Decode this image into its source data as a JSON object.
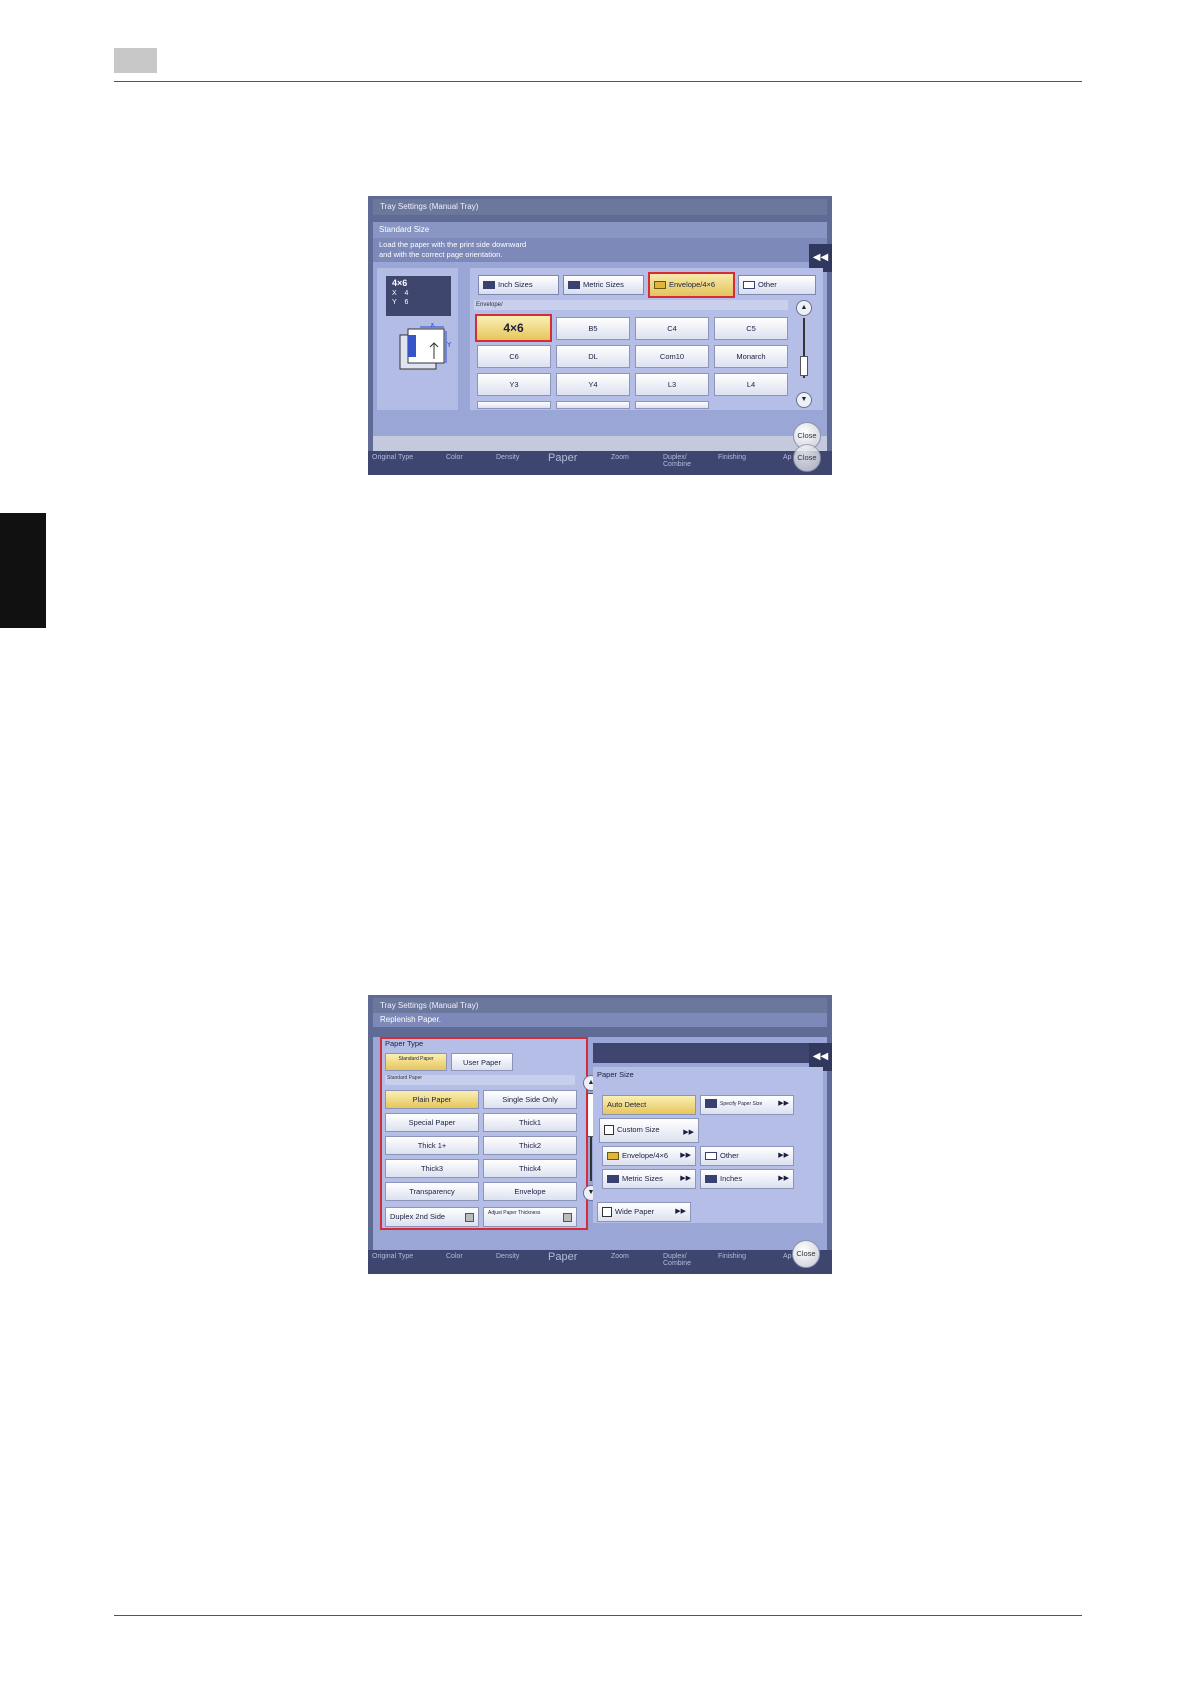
{
  "screen1": {
    "title": "Tray Settings (Manual Tray)",
    "subtitle": "Standard Size",
    "message_line1": "Load the paper with the print side downward",
    "message_line2": "and with the correct page orientation.",
    "preview": {
      "size": "4×6",
      "x_label": "X",
      "x_value": "4",
      "y_label": "Y",
      "y_value": "6"
    },
    "tabs": [
      {
        "label": "Inch Sizes"
      },
      {
        "label": "Metric Sizes"
      },
      {
        "label": "Envelope/4×6"
      },
      {
        "label": "Other"
      }
    ],
    "section_label": "Envelope/",
    "buttons": [
      "4×6",
      "B5",
      "C4",
      "C5",
      "C6",
      "DL",
      "Com10",
      "Monarch",
      "Y3",
      "Y4",
      "L3",
      "L4"
    ],
    "close_label": "Close",
    "close_label2": "Close",
    "bottom_labels": [
      "Original Type",
      "Color",
      "Density",
      "Paper",
      "Zoom",
      "Duplex/ Combine",
      "Finishing",
      "Ap"
    ]
  },
  "screen2": {
    "title": "Tray Settings (Manual Tray)",
    "message": "Replenish Paper.",
    "paper_type": {
      "heading": "Paper Type",
      "tab_standard": "Standard Paper",
      "tab_user": "User Paper",
      "section_label": "Standard Paper",
      "buttons": [
        "Plain Paper",
        "Single Side Only",
        "Special Paper",
        "Thick1",
        "Thick 1+",
        "Thick2",
        "Thick3",
        "Thick4",
        "Transparency",
        "Envelope"
      ],
      "duplex": "Duplex 2nd Side",
      "adjust": "Adjust Paper Thickness"
    },
    "paper_size": {
      "heading": "Paper Size",
      "auto_detect": "Auto Detect",
      "specify": "Specify Paper Size",
      "custom": "Custom Size",
      "envelope": "Envelope/4×6",
      "other": "Other",
      "metric": "Metric Sizes",
      "inches": "Inches",
      "wide": "Wide Paper"
    },
    "close_label": "Close",
    "bottom_labels": [
      "Original Type",
      "Color",
      "Density",
      "Paper",
      "Zoom",
      "Duplex/ Combine",
      "Finishing",
      "Ap"
    ]
  }
}
